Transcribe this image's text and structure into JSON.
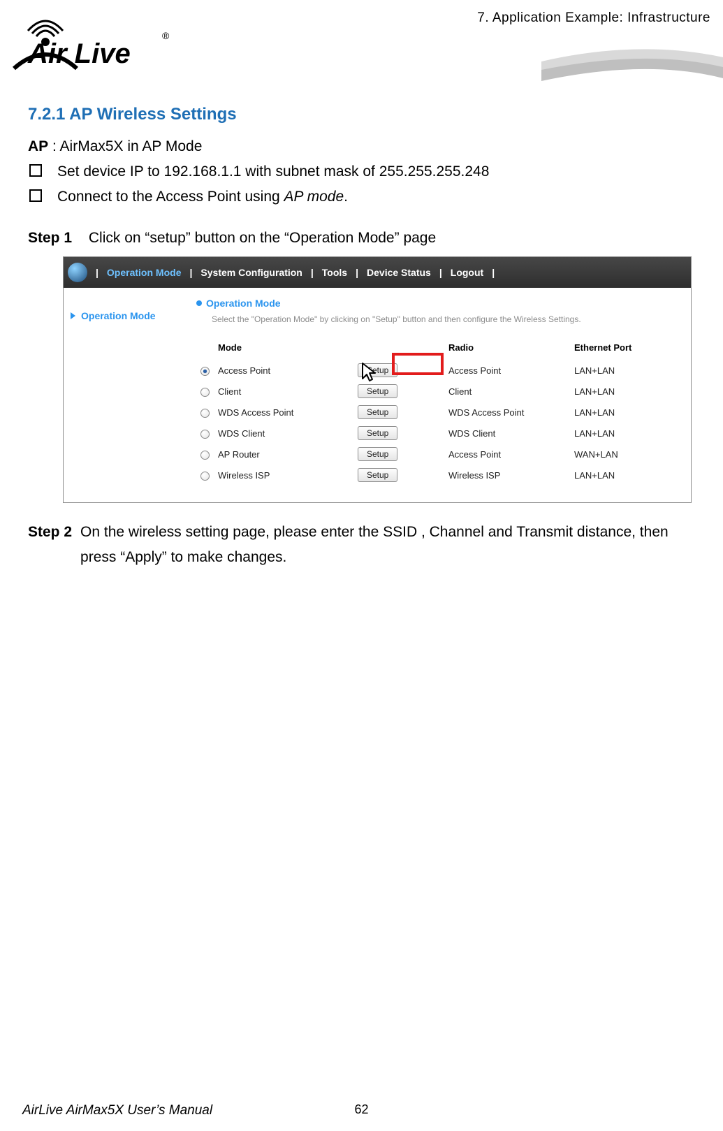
{
  "header": {
    "chapter": "7.  Application  Example:  Infrastructure"
  },
  "logo": {
    "text_main": "Air Live",
    "registered": "®"
  },
  "section": {
    "heading": "7.2.1 AP Wireless Settings",
    "ap_label": "AP",
    "ap_desc": " : AirMax5X in AP Mode",
    "bullets": [
      "Set device IP to 192.168.1.1 with subnet mask of 255.255.255.248",
      "Connect to the Access Point using "
    ],
    "bullet2_italic": "AP mode",
    "bullet2_tail": "."
  },
  "step1": {
    "label": "Step 1",
    "text": "Click on “setup” button on the “Operation Mode” page"
  },
  "step2": {
    "label": "Step 2",
    "text": "On the wireless setting page, please enter the SSID , Channel and Transmit distance, then press “Apply” to make changes."
  },
  "shot": {
    "nav": {
      "sep": "|",
      "items": [
        "Operation Mode",
        "System Configuration",
        "Tools",
        "Device Status",
        "Logout"
      ],
      "selected_index": 0
    },
    "sidebar": {
      "item": "Operation Mode"
    },
    "title": "Operation Mode",
    "desc": "Select the \"Operation Mode\" by clicking on \"Setup\" button and then configure the Wireless Settings.",
    "columns": {
      "mode": "Mode",
      "radio": "Radio",
      "eth": "Ethernet Port"
    },
    "setup_label": "Setup",
    "rows": [
      {
        "mode": "Access Point",
        "checked": true,
        "radio": "Access Point",
        "eth": "LAN+LAN"
      },
      {
        "mode": "Client",
        "checked": false,
        "radio": "Client",
        "eth": "LAN+LAN"
      },
      {
        "mode": "WDS Access Point",
        "checked": false,
        "radio": "WDS Access Point",
        "eth": "LAN+LAN"
      },
      {
        "mode": "WDS Client",
        "checked": false,
        "radio": "WDS Client",
        "eth": "LAN+LAN"
      },
      {
        "mode": "AP Router",
        "checked": false,
        "radio": "Access Point",
        "eth": "WAN+LAN"
      },
      {
        "mode": "Wireless ISP",
        "checked": false,
        "radio": "Wireless ISP",
        "eth": "LAN+LAN"
      }
    ]
  },
  "footer": {
    "page_number": "62",
    "manual": "AirLive AirMax5X User’s Manual"
  }
}
